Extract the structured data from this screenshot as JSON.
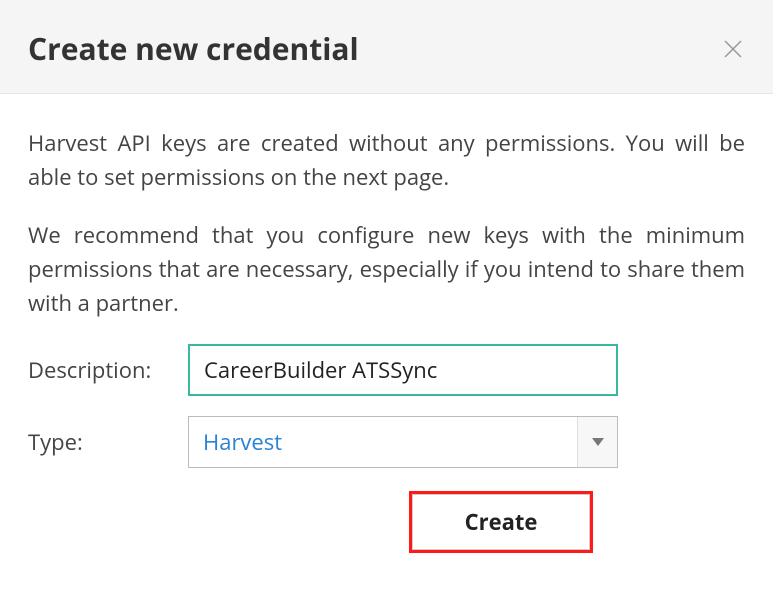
{
  "header": {
    "title": "Create new credential"
  },
  "body": {
    "paragraph1": "Harvest API keys are created without any permissions. You will be able to set permissions on the next page.",
    "paragraph2": "We recommend that you configure new keys with the minimum permissions that are necessary, especially if you intend to share them with a partner."
  },
  "form": {
    "description_label": "Description:",
    "description_value": "CareerBuilder ATSSync",
    "type_label": "Type:",
    "type_value": "Harvest",
    "create_button": "Create"
  }
}
